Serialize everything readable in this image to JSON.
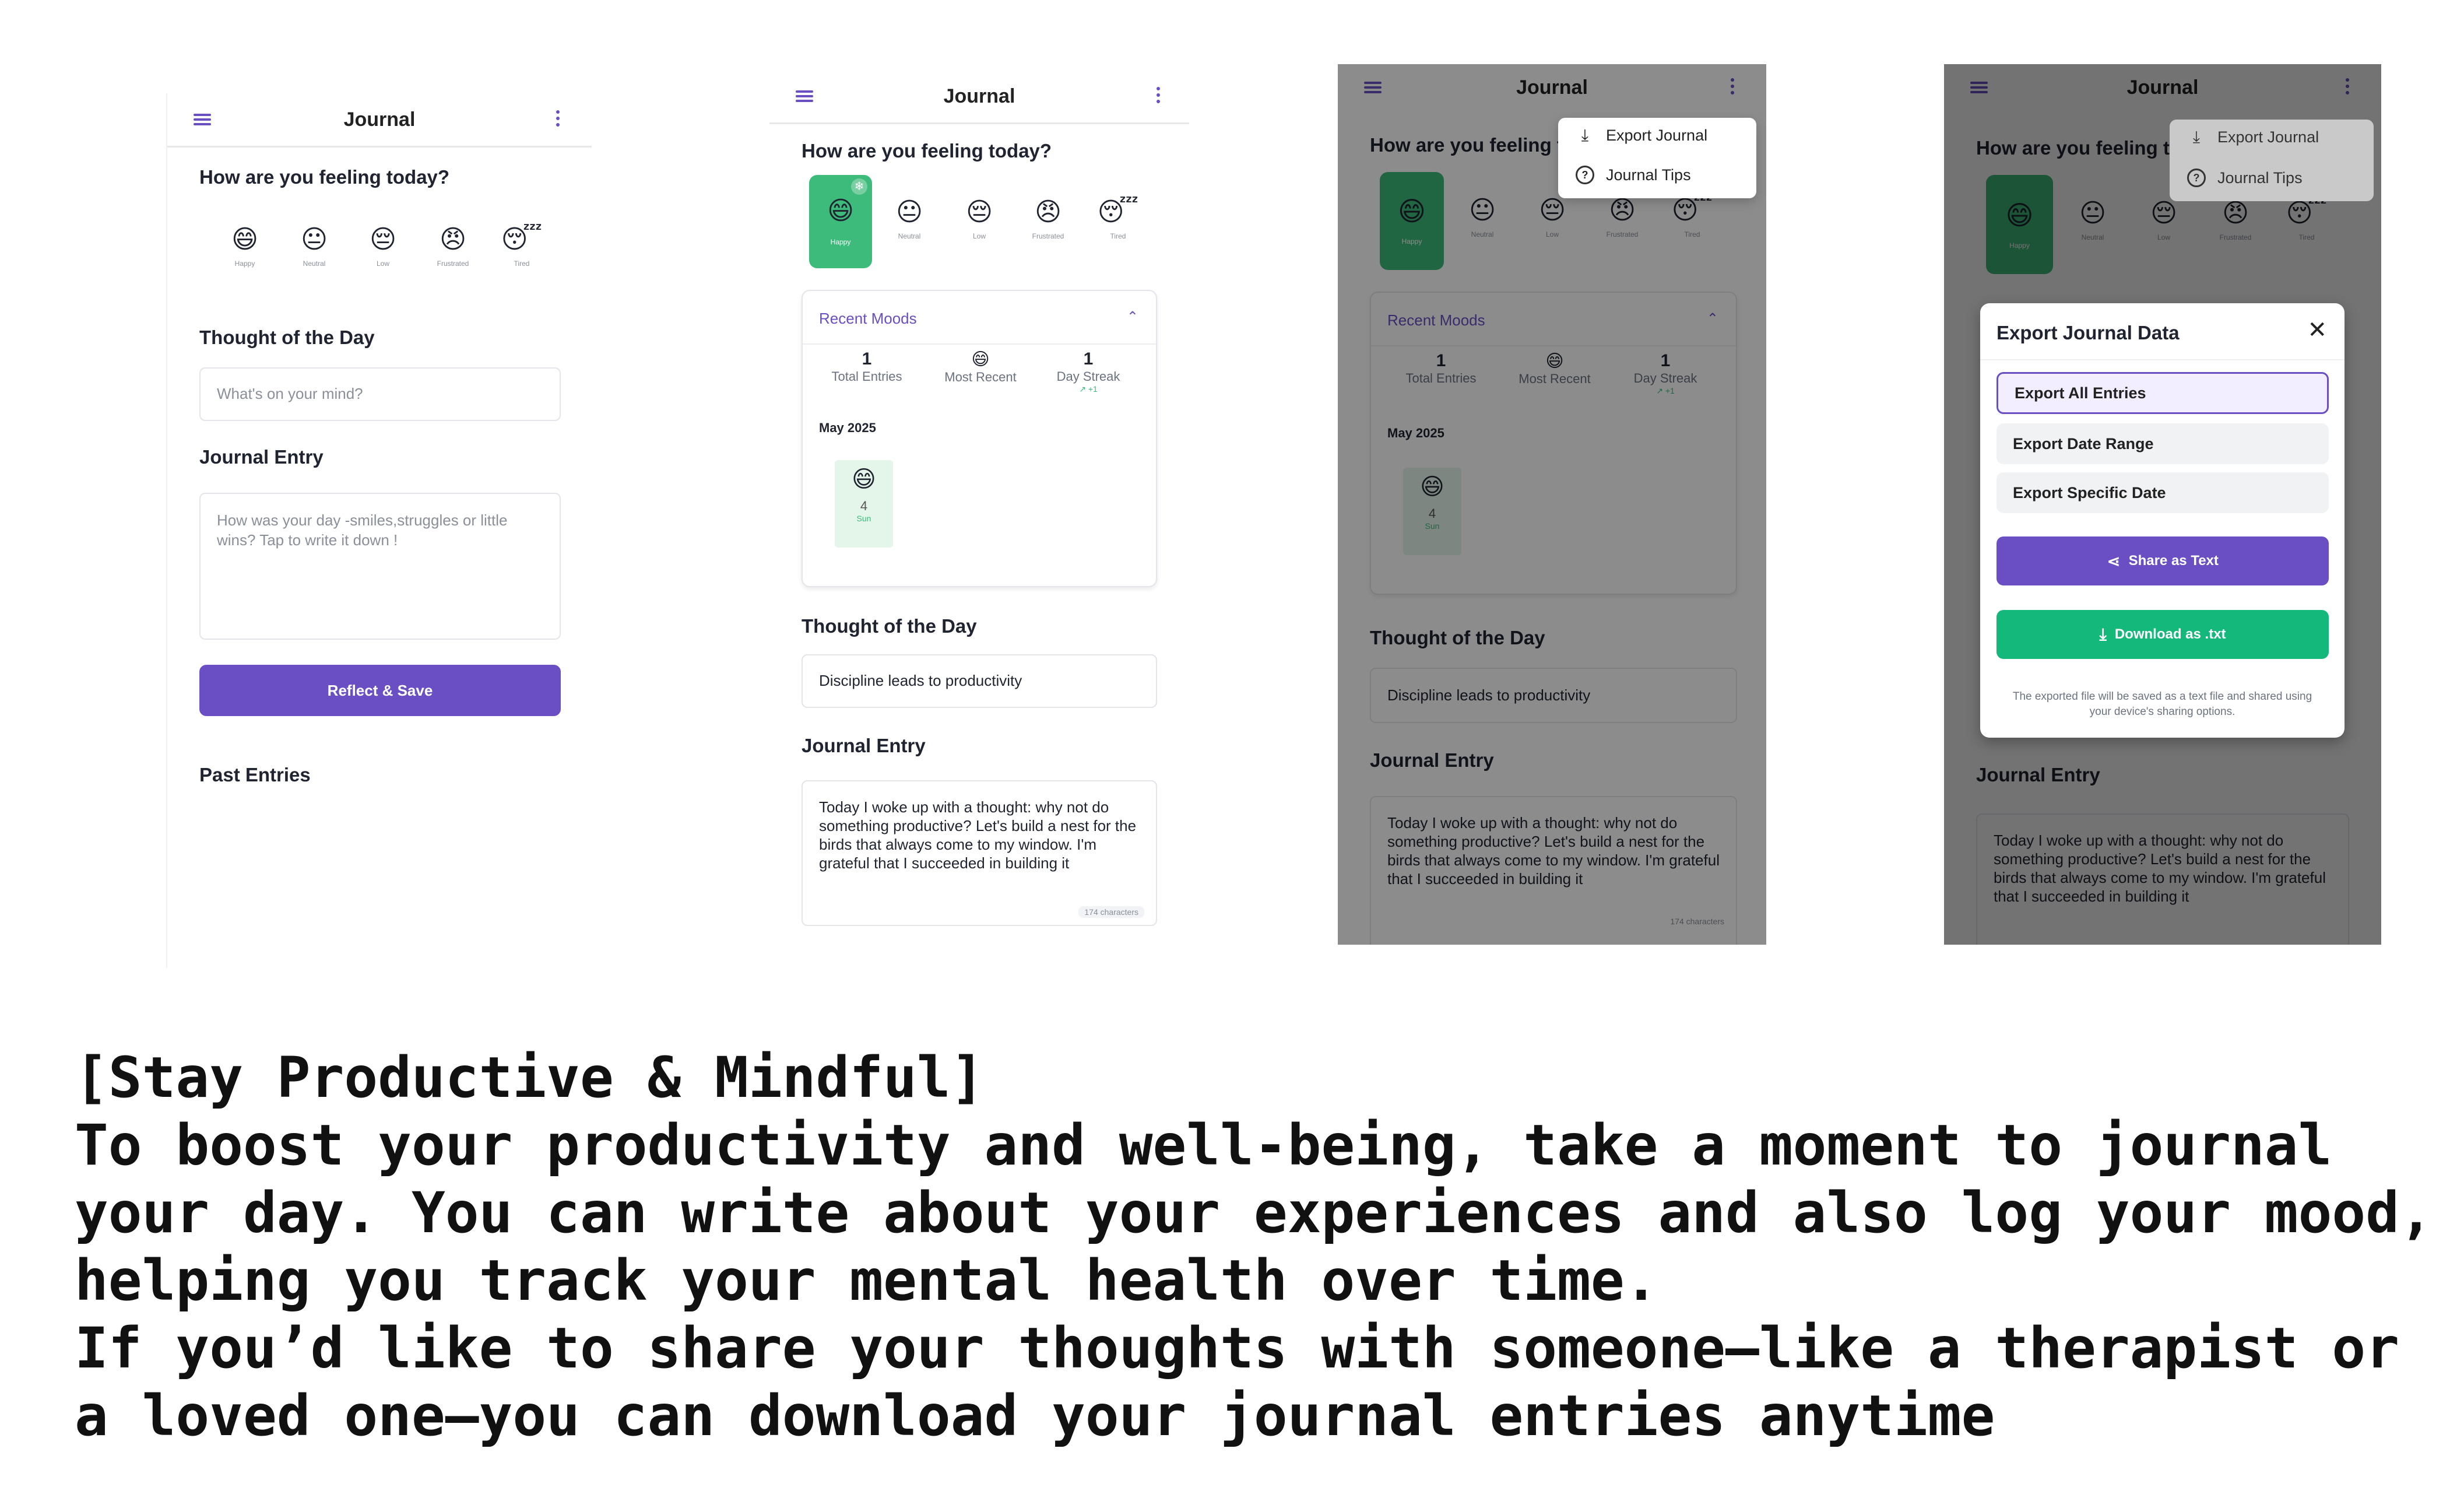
{
  "app": {
    "title": "Journal"
  },
  "moods": [
    {
      "face": "😄",
      "label": "Happy"
    },
    {
      "face": "😐",
      "label": "Neutral"
    },
    {
      "face": "😔",
      "label": "Low"
    },
    {
      "face": "😠",
      "label": "Frustrated"
    },
    {
      "face": "😴",
      "label": "Tired"
    }
  ],
  "selected_mood": "Happy",
  "labels": {
    "feeling_question": "How are you feeling today?",
    "thought_heading": "Thought of the Day",
    "journal_heading": "Journal Entry",
    "past_entries": "Past Entries",
    "reflect_save": "Reflect & Save",
    "sparkle_icon": "❄"
  },
  "inputs": {
    "thought_placeholder": "What's on your mind?",
    "journal_placeholder": "How was your day -smiles,struggles or little wins? Tap to write it down !",
    "thought_value": "Discipline leads to productivity",
    "journal_value": "Today I woke up with a  thought: why not do something productive? Let's build a nest for the birds that always come to my window. I'm grateful that I succeeded in building it",
    "char_count": "174 characters"
  },
  "recent_moods": {
    "title": "Recent Moods",
    "total_entries_value": "1",
    "total_entries_label": "Total Entries",
    "most_recent_face": "😄",
    "most_recent_label": "Most Recent",
    "streak_value": "1",
    "streak_label": "Day Streak",
    "streak_delta": "↗ +1",
    "month": "May 2025",
    "day_face": "😄",
    "day_number": "4",
    "day_name": "Sun"
  },
  "dropdown_menu": {
    "export_label": "Export Journal",
    "tips_label": "Journal Tips"
  },
  "export_dialog": {
    "title": "Export Journal Data",
    "options": [
      "Export All Entries",
      "Export Date Range",
      "Export Specific Date"
    ],
    "share_label": "Share as Text",
    "download_label": "Download as .txt",
    "note": "The exported file will be saved as a text file and shared using your device's sharing options."
  },
  "caption": {
    "heading": "[Stay Productive & Mindful]",
    "line1": "To boost your productivity and well-being, take a moment to journal your day. You can write about your experiences and also log your mood, helping you track your mental health over time.",
    "line2": "If you’d like to share your thoughts with someone—like a therapist or a loved one—you can download your journal entries anytime"
  },
  "colors": {
    "accent": "#6a4fc4",
    "happy_green": "#3dbb7a",
    "download_green": "#14b87a",
    "overlay": "rgba(0,0,0,0.45)"
  }
}
